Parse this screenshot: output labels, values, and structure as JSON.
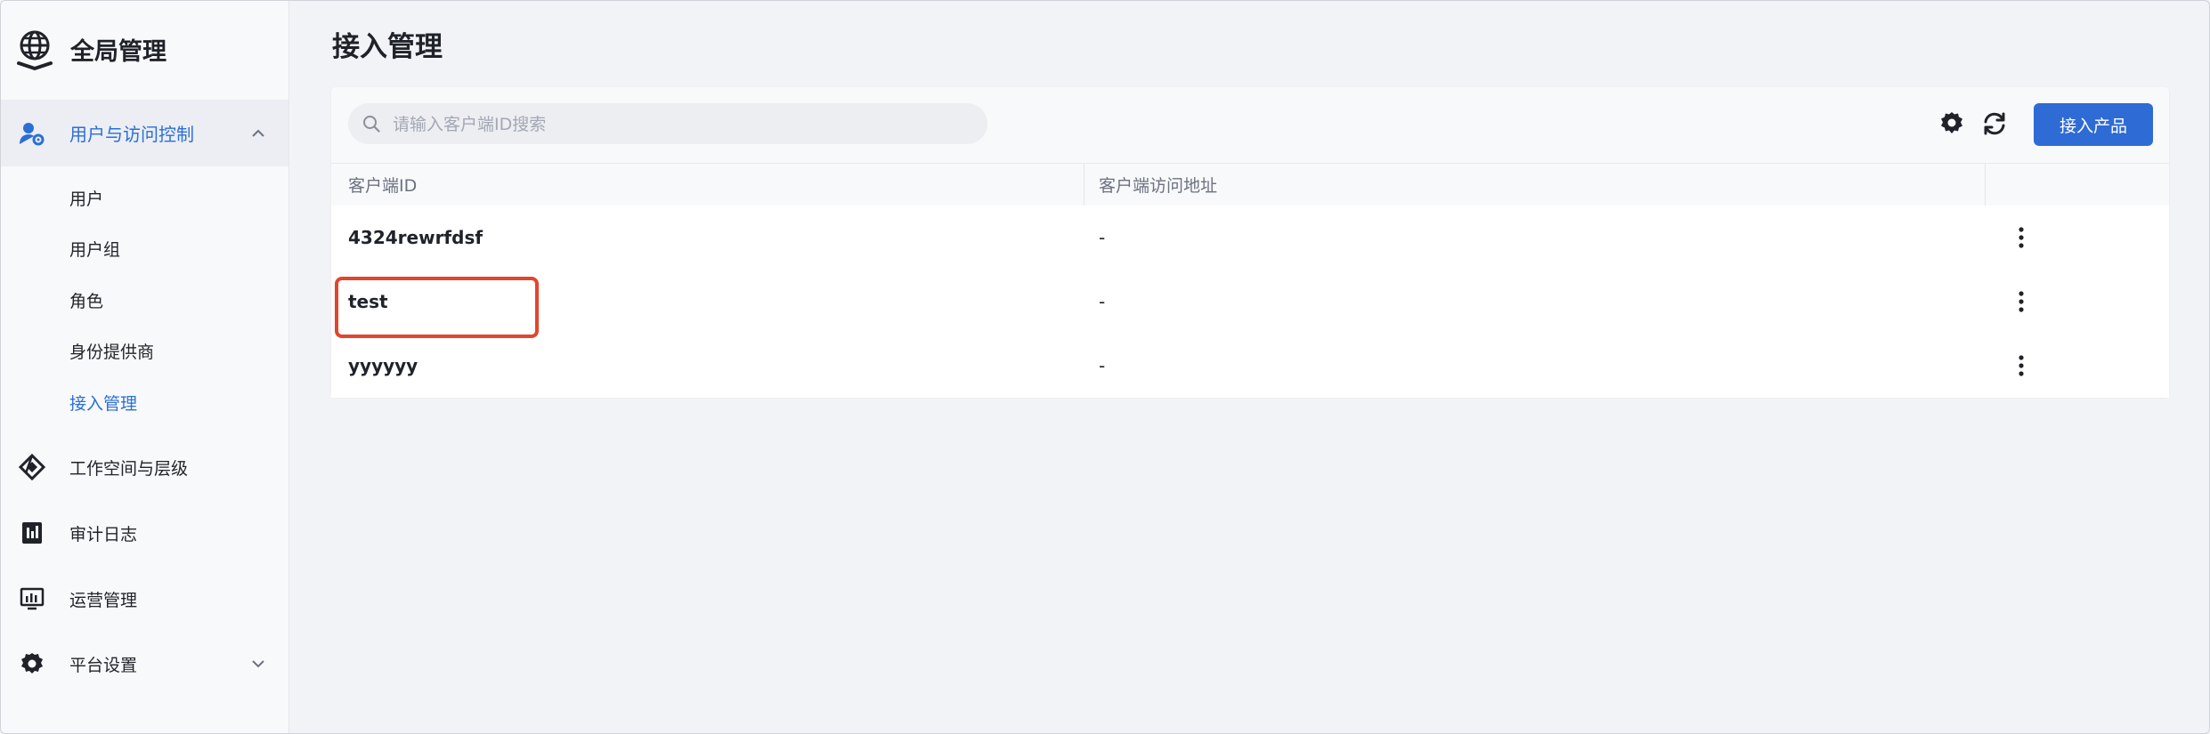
{
  "sidebar": {
    "brand_title": "全局管理",
    "groups": [
      {
        "label": "用户与访问控制",
        "icon": "user-gear-icon",
        "expanded": true,
        "children": [
          {
            "label": "用户"
          },
          {
            "label": "用户组"
          },
          {
            "label": "角色"
          },
          {
            "label": "身份提供商"
          },
          {
            "label": "接入管理",
            "active": true
          }
        ]
      },
      {
        "label": "工作空间与层级",
        "icon": "workspace-icon"
      },
      {
        "label": "审计日志",
        "icon": "audit-log-icon"
      },
      {
        "label": "运营管理",
        "icon": "operations-icon"
      },
      {
        "label": "平台设置",
        "icon": "gear-icon",
        "expandable": true
      }
    ]
  },
  "main": {
    "title": "接入管理",
    "search": {
      "placeholder": "请输入客户端ID搜索",
      "value": ""
    },
    "primary_button": "接入产品",
    "table": {
      "columns": [
        "客户端ID",
        "客户端访问地址"
      ],
      "rows": [
        {
          "client_id": "4324rewrfdsf",
          "address": "-"
        },
        {
          "client_id": "test",
          "address": "-"
        },
        {
          "client_id": "yyyyyy",
          "address": "-"
        }
      ]
    }
  },
  "colors": {
    "accent": "#2e6bd4",
    "highlight": "#e2452d",
    "sidebar_bg": "#f8f9fb",
    "page_bg": "#f2f3f7"
  }
}
